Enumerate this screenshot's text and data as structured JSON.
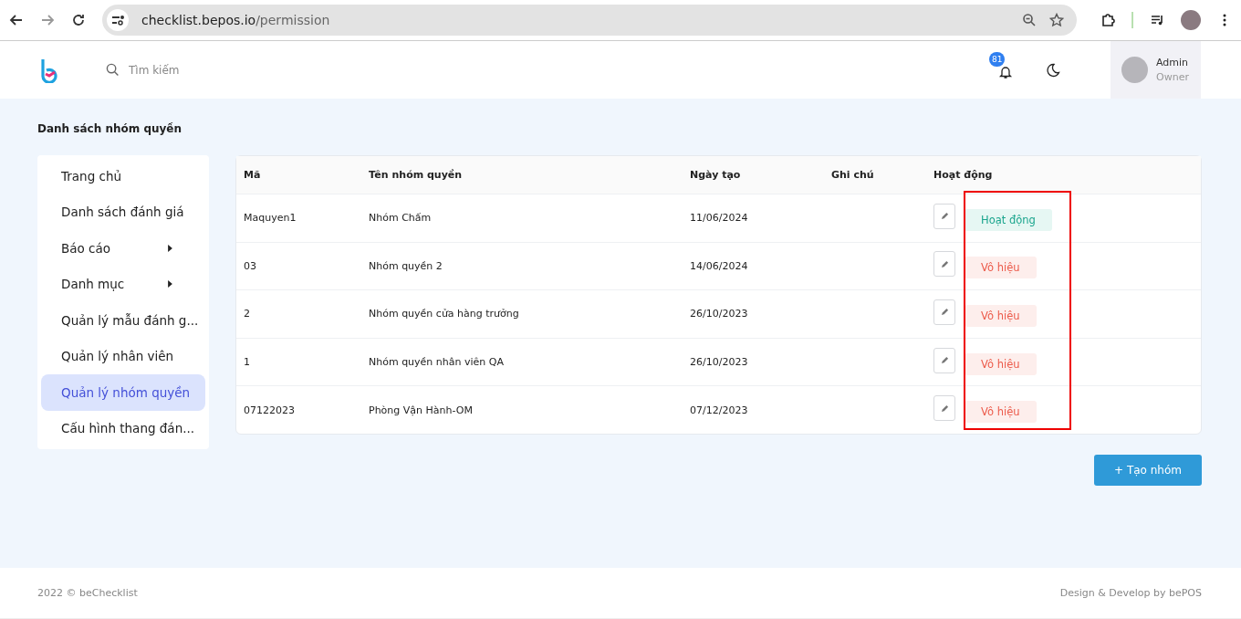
{
  "browser": {
    "url_host": "checklist.bepos.io",
    "url_path": "/permission"
  },
  "header": {
    "search": {
      "placeholder": "Tìm kiếm"
    },
    "notification_count": "81",
    "user": {
      "name": "Admin",
      "role": "Owner"
    }
  },
  "page_title": "Danh sách nhóm quyền",
  "sidebar": {
    "items": [
      {
        "label": "Trang chủ",
        "selected": false,
        "has_submenu": false
      },
      {
        "label": "Danh sách đánh giá",
        "selected": false,
        "has_submenu": false
      },
      {
        "label": "Báo cáo",
        "selected": false,
        "has_submenu": true
      },
      {
        "label": "Danh mục",
        "selected": false,
        "has_submenu": true
      },
      {
        "label": "Quản lý mẫu đánh g...",
        "selected": false,
        "has_submenu": false
      },
      {
        "label": "Quản lý nhân viên",
        "selected": false,
        "has_submenu": false
      },
      {
        "label": "Quản lý nhóm quyền",
        "selected": true,
        "has_submenu": false
      },
      {
        "label": "Cấu hình thang đán...",
        "selected": false,
        "has_submenu": false
      }
    ]
  },
  "table": {
    "columns": [
      "Mã",
      "Tên nhóm quyền",
      "Ngày tạo",
      "Ghi chú",
      "Hoạt động"
    ],
    "rows": [
      {
        "code": "Maquyen1",
        "name": "Nhóm Chấm",
        "created": "11/06/2024",
        "status": "Hoạt động",
        "active": true
      },
      {
        "code": "03",
        "name": "Nhóm quyền 2",
        "created": "14/06/2024",
        "status": "Vô hiệu",
        "active": false
      },
      {
        "code": "2",
        "name": "Nhóm quyền cửa hàng trưởng",
        "created": "26/10/2023",
        "status": "Vô hiệu",
        "active": false
      },
      {
        "code": "1",
        "name": "Nhóm quyền nhân viên QA",
        "created": "26/10/2023",
        "status": "Vô hiệu",
        "active": false
      },
      {
        "code": "07122023",
        "name": "Phòng Vận Hành-OM",
        "created": "07/12/2023",
        "status": "Vô hiệu",
        "active": false
      }
    ]
  },
  "create_button": "+ Tạo nhóm",
  "footer": {
    "left": "2022 © beChecklist",
    "right": "Design & Develop by bePOS"
  }
}
